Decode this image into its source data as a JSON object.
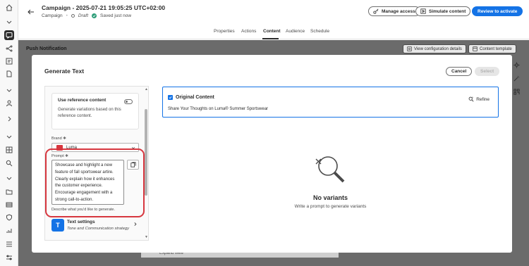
{
  "header": {
    "title": "Campaign - 2025-07-21 19:05:25 UTC+02:00",
    "type_label": "Campaign",
    "status": "Draft",
    "saved_text": "Saved just now",
    "manage_access": "Manage access",
    "simulate_content": "Simulate content",
    "review_to_activate": "Review to activate"
  },
  "tabs": [
    "Properties",
    "Actions",
    "Content",
    "Audience",
    "Schedule"
  ],
  "active_tab": "Content",
  "background": {
    "section_title": "Push Notification",
    "view_config": "View configuration details",
    "content_template": "Content template",
    "expand_view": "Expand view"
  },
  "modal": {
    "title": "Generate Text",
    "cancel": "Cancel",
    "select": "Select",
    "reference": {
      "title": "Use reference content",
      "description": "Generate variations based on this reference content."
    },
    "brand": {
      "label": "Brand",
      "value": "Luma"
    },
    "prompt": {
      "label": "Prompt",
      "value": "Showcase and highlight a new feature of fall sportswear artire. Clearly explain how it enhances the customer experience. Encourage engagement with a strong call-to-action.",
      "help": "Describe what you'd like to generate."
    },
    "text_settings": {
      "title": "Text settings",
      "subtitle": "Tone and Communication strategy"
    },
    "original": {
      "title": "Original Content",
      "text": "Share Your Thoughts on Luma® Summer Sportswear",
      "refine": "Refine"
    },
    "empty": {
      "title": "No variants",
      "subtitle": "Write a prompt to generate variants"
    }
  },
  "colors": {
    "accent": "#1473e6",
    "highlight": "#d7373f",
    "success": "#2d9d78"
  }
}
